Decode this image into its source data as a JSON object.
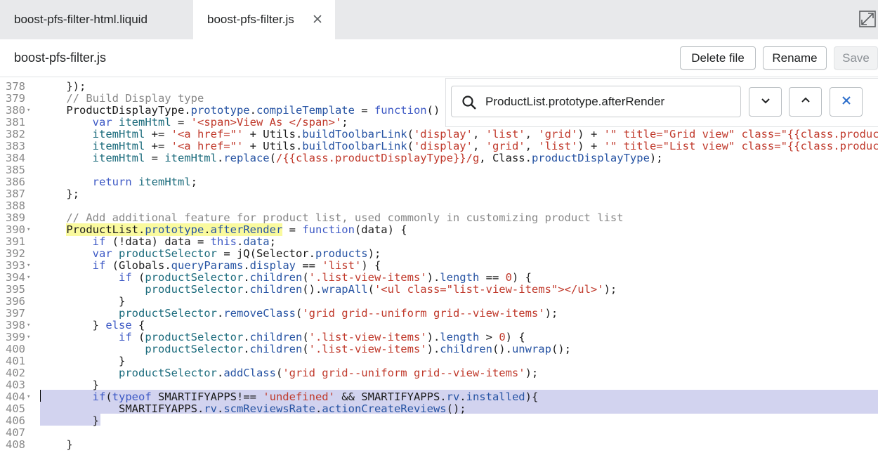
{
  "tabs": [
    {
      "label": "boost-pfs-filter-html.liquid",
      "active": false
    },
    {
      "label": "boost-pfs-filter.js",
      "active": true
    }
  ],
  "header": {
    "file_title": "boost-pfs-filter.js",
    "delete_label": "Delete file",
    "rename_label": "Rename",
    "save_label": "Save"
  },
  "search": {
    "value": "ProductList.prototype.afterRender"
  },
  "lines": [
    {
      "n": "378",
      "fold": false,
      "html": "    });"
    },
    {
      "n": "379",
      "fold": false,
      "html": "    <span class=\"cm\">// Build Display type</span>"
    },
    {
      "n": "380",
      "fold": true,
      "html": "    ProductDisplayType.<span class=\"prop\">prototype</span>.<span class=\"prop\">compileTemplate</span> = <span class=\"kw\">function</span>() {"
    },
    {
      "n": "381",
      "fold": false,
      "html": "        <span class=\"kw\">var</span> <span class=\"var\">itemHtml</span> = <span class=\"str\">'&lt;span&gt;View As &lt;/span&gt;'</span>;"
    },
    {
      "n": "382",
      "fold": false,
      "html": "        <span class=\"var\">itemHtml</span> += <span class=\"str\">'&lt;a href=\"'</span> + Utils.<span class=\"prop\">buildToolbarLink</span>(<span class=\"str\">'display'</span>, <span class=\"str\">'list'</span>, <span class=\"str\">'grid'</span>) + <span class=\"str\">'\" title=\"Grid view\" class=\"{{class.product</span>"
    },
    {
      "n": "383",
      "fold": false,
      "html": "        <span class=\"var\">itemHtml</span> += <span class=\"str\">'&lt;a href=\"'</span> + Utils.<span class=\"prop\">buildToolbarLink</span>(<span class=\"str\">'display'</span>, <span class=\"str\">'grid'</span>, <span class=\"str\">'list'</span>) + <span class=\"str\">'\" title=\"List view\" class=\"{{class.product</span>"
    },
    {
      "n": "384",
      "fold": false,
      "html": "        <span class=\"var\">itemHtml</span> = <span class=\"var\">itemHtml</span>.<span class=\"prop\">replace</span>(<span class=\"str\">/{{class.productDisplayType}}/g</span>, Class.<span class=\"prop\">productDisplayType</span>);"
    },
    {
      "n": "385",
      "fold": false,
      "html": ""
    },
    {
      "n": "386",
      "fold": false,
      "html": "        <span class=\"kw\">return</span> <span class=\"var\">itemHtml</span>;"
    },
    {
      "n": "387",
      "fold": false,
      "html": "    };"
    },
    {
      "n": "388",
      "fold": false,
      "html": ""
    },
    {
      "n": "389",
      "fold": false,
      "html": "    <span class=\"cm\">// Add additional feature for product list, used commonly in customizing product list</span>"
    },
    {
      "n": "390",
      "fold": true,
      "html": "    <span class=\"hl\">ProductList.<span class=\"prop\">prototype</span>.<span class=\"prop\">afterRender</span></span> = <span class=\"kw\">function</span>(data) {"
    },
    {
      "n": "391",
      "fold": false,
      "html": "        <span class=\"kw\">if</span> (!data) data = <span class=\"kw\">this</span>.<span class=\"prop\">data</span>;"
    },
    {
      "n": "392",
      "fold": false,
      "html": "        <span class=\"kw\">var</span> <span class=\"var\">productSelector</span> = jQ(Selector.<span class=\"prop\">products</span>);"
    },
    {
      "n": "393",
      "fold": true,
      "html": "        <span class=\"kw\">if</span> (Globals.<span class=\"prop\">queryParams</span>.<span class=\"prop\">display</span> == <span class=\"str\">'list'</span>) {"
    },
    {
      "n": "394",
      "fold": true,
      "html": "            <span class=\"kw\">if</span> (<span class=\"var\">productSelector</span>.<span class=\"prop\">children</span>(<span class=\"str\">'.list-view-items'</span>).<span class=\"prop\">length</span> == <span class=\"str\">0</span>) {"
    },
    {
      "n": "395",
      "fold": false,
      "html": "                <span class=\"var\">productSelector</span>.<span class=\"prop\">children</span>().<span class=\"prop\">wrapAll</span>(<span class=\"str\">'&lt;ul class=\"list-view-items\"&gt;&lt;/ul&gt;'</span>);"
    },
    {
      "n": "396",
      "fold": false,
      "html": "            }"
    },
    {
      "n": "397",
      "fold": false,
      "html": "            <span class=\"var\">productSelector</span>.<span class=\"prop\">removeClass</span>(<span class=\"str\">'grid grid--uniform grid--view-items'</span>);"
    },
    {
      "n": "398",
      "fold": true,
      "html": "        } <span class=\"kw\">else</span> {"
    },
    {
      "n": "399",
      "fold": true,
      "html": "            <span class=\"kw\">if</span> (<span class=\"var\">productSelector</span>.<span class=\"prop\">children</span>(<span class=\"str\">'.list-view-items'</span>).<span class=\"prop\">length</span> &gt; <span class=\"str\">0</span>) {"
    },
    {
      "n": "400",
      "fold": false,
      "html": "                <span class=\"var\">productSelector</span>.<span class=\"prop\">children</span>(<span class=\"str\">'.list-view-items'</span>).<span class=\"prop\">children</span>().<span class=\"prop\">unwrap</span>();"
    },
    {
      "n": "401",
      "fold": false,
      "html": "            }"
    },
    {
      "n": "402",
      "fold": false,
      "html": "            <span class=\"var\">productSelector</span>.<span class=\"prop\">addClass</span>(<span class=\"str\">'grid grid--uniform grid--view-items'</span>);"
    },
    {
      "n": "403",
      "fold": false,
      "html": "        }"
    },
    {
      "n": "404",
      "fold": true,
      "html": "        <span class=\"kw\">if</span>(<span class=\"kw\">typeof</span> SMARTIFYAPPS!== <span class=\"str\">'undefined'</span> &amp;&amp; SMARTIFYAPPS.<span class=\"prop\">rv</span>.<span class=\"prop\">installed</span>){"
    },
    {
      "n": "405",
      "fold": false,
      "html": "            SMARTIFYAPPS.<span class=\"prop\">rv</span>.<span class=\"prop\">scmReviewsRate</span>.<span class=\"prop\">actionCreateReviews</span>();"
    },
    {
      "n": "406",
      "fold": false,
      "html": "        }"
    },
    {
      "n": "407",
      "fold": false,
      "html": ""
    },
    {
      "n": "408",
      "fold": false,
      "html": "    }"
    }
  ],
  "icons": {
    "tab_close": "close-icon",
    "expand": "fullscreen-icon",
    "search": "search-icon",
    "next": "chevron-down-icon",
    "prev": "chevron-up-icon",
    "close_search": "close-icon"
  },
  "colors": {
    "accent": "#2c6ecb",
    "selection": "#d2d3ef",
    "match_highlight": "#fafa9e"
  }
}
